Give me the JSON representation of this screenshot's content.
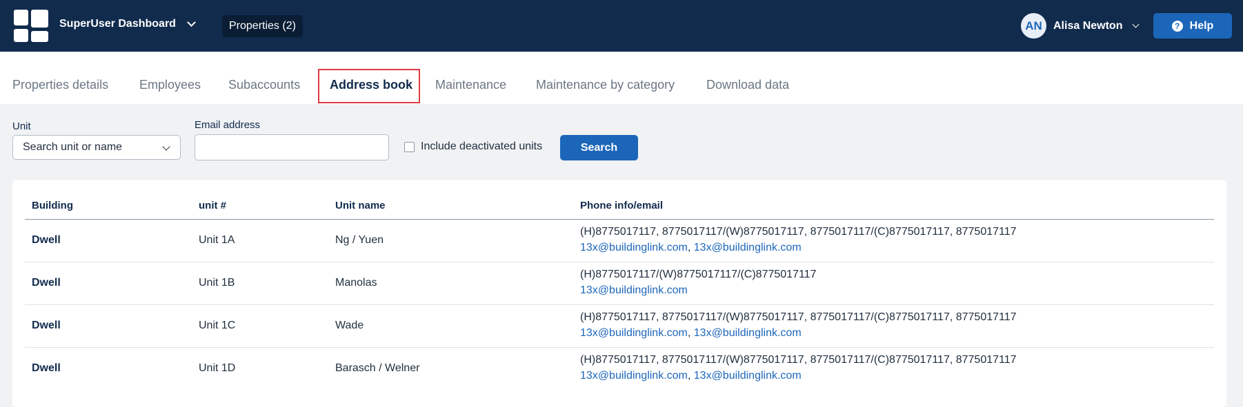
{
  "header": {
    "dashboard_title": "SuperUser Dashboard",
    "properties_button": "Properties (2)",
    "user": {
      "initials": "AN",
      "name": "Alisa Newton"
    },
    "help_label": "Help",
    "colors": {
      "bar": "#112b4d",
      "accent": "#1c66b9"
    }
  },
  "tabs": [
    {
      "label": "Properties details"
    },
    {
      "label": "Employees"
    },
    {
      "label": "Subaccounts"
    },
    {
      "label": "Address book",
      "active": true
    },
    {
      "label": "Maintenance"
    },
    {
      "label": "Maintenance by category"
    },
    {
      "label": "Download data"
    }
  ],
  "filters": {
    "unit_label": "Unit",
    "unit_select_value": "Search unit or name",
    "email_label": "Email address",
    "email_value": "",
    "include_deactivated_label": "Include deactivated units",
    "include_deactivated_checked": false,
    "search_label": "Search"
  },
  "table": {
    "columns": [
      "Building",
      "unit #",
      "Unit name",
      "Phone info/email"
    ],
    "rows": [
      {
        "building": "Dwell",
        "unit": "Unit 1A",
        "unit_name": "Ng / Yuen",
        "phone": "(H)8775017117, 8775017117/(W)8775017117, 8775017117/(C)8775017117, 8775017117",
        "emails": [
          "13x@buildinglink.com",
          "13x@buildinglink.com"
        ]
      },
      {
        "building": "Dwell",
        "unit": "Unit 1B",
        "unit_name": "Manolas",
        "phone": "(H)8775017117/(W)8775017117/(C)8775017117",
        "emails": [
          "13x@buildinglink.com"
        ]
      },
      {
        "building": "Dwell",
        "unit": "Unit 1C",
        "unit_name": "Wade",
        "phone": "(H)8775017117, 8775017117/(W)8775017117, 8775017117/(C)8775017117, 8775017117",
        "emails": [
          "13x@buildinglink.com",
          "13x@buildinglink.com"
        ]
      },
      {
        "building": "Dwell",
        "unit": "Unit 1D",
        "unit_name": "Barasch / Welner",
        "phone": "(H)8775017117, 8775017117/(W)8775017117, 8775017117/(C)8775017117, 8775017117",
        "emails": [
          "13x@buildinglink.com",
          "13x@buildinglink.com"
        ]
      }
    ]
  }
}
